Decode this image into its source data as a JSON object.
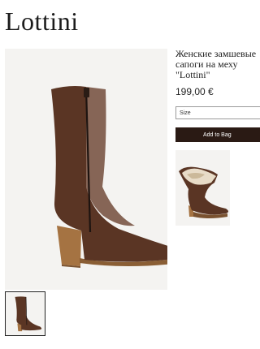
{
  "brand": "Lottini",
  "product": {
    "title": "Женские замшевые\nсапоги на меху\n\"Lottini\"",
    "price": "199,00 €"
  },
  "size_select": {
    "label": "Size"
  },
  "add_to_bag": {
    "label": "Add to Bag"
  },
  "colors": {
    "suede": "#5a3524",
    "heel": "#a57342",
    "button": "#2a1a14"
  }
}
